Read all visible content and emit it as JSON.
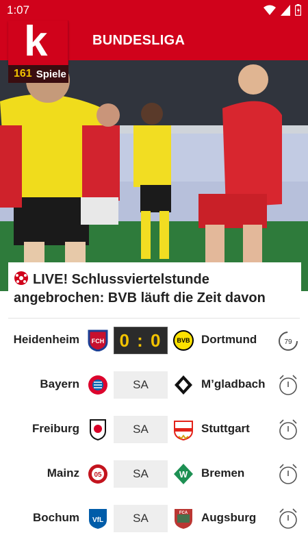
{
  "status_bar": {
    "time": "1:07"
  },
  "header": {
    "title": "BUNDESLIGA",
    "logo_letter": "k",
    "games_count": "161",
    "games_label": "Spiele"
  },
  "headline": {
    "text": "LIVE! Schlussviertelstunde angebrochen: BVB läuft die Zeit davon"
  },
  "matches": [
    {
      "home": "Heidenheim",
      "away": "Dortmund",
      "score": "0 : 0",
      "live": true,
      "minute": "79",
      "home_crest": "heidenheim-crest",
      "away_crest": "dortmund-crest"
    },
    {
      "home": "Bayern",
      "away": "M’gladbach",
      "score": "SA",
      "live": false,
      "home_crest": "bayern-crest",
      "away_crest": "gladbach-crest"
    },
    {
      "home": "Freiburg",
      "away": "Stuttgart",
      "score": "SA",
      "live": false,
      "home_crest": "freiburg-crest",
      "away_crest": "stuttgart-crest"
    },
    {
      "home": "Mainz",
      "away": "Bremen",
      "score": "SA",
      "live": false,
      "home_crest": "mainz-crest",
      "away_crest": "bremen-crest"
    },
    {
      "home": "Bochum",
      "away": "Augsburg",
      "score": "SA",
      "live": false,
      "home_crest": "bochum-crest",
      "away_crest": "augsburg-crest"
    }
  ],
  "colors": {
    "brand_red": "#d0021b",
    "score_yellow": "#f2c200",
    "badge_dark": "#3a0d10"
  }
}
